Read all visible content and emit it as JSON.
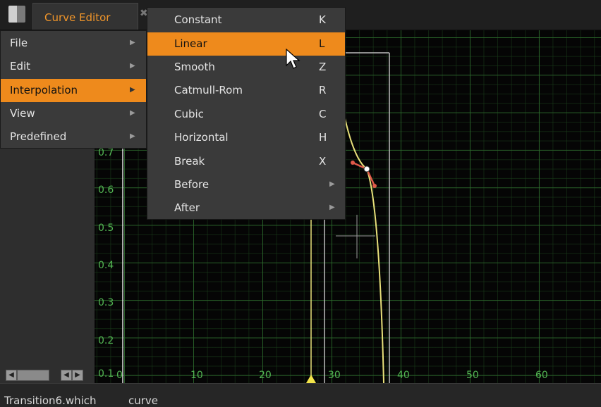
{
  "tab": {
    "label": "Curve Editor",
    "close": "✖"
  },
  "menu": {
    "items": [
      {
        "label": "File",
        "has_submenu": true,
        "active": false
      },
      {
        "label": "Edit",
        "has_submenu": true,
        "active": false
      },
      {
        "label": "Interpolation",
        "has_submenu": true,
        "active": true
      },
      {
        "label": "View",
        "has_submenu": true,
        "active": false
      },
      {
        "label": "Predefined",
        "has_submenu": true,
        "active": false
      }
    ]
  },
  "submenu": {
    "items": [
      {
        "label": "Constant",
        "shortcut": "K",
        "active": false
      },
      {
        "label": "Linear",
        "shortcut": "L",
        "active": true
      },
      {
        "label": "Smooth",
        "shortcut": "Z",
        "active": false
      },
      {
        "label": "Catmull-Rom",
        "shortcut": "R",
        "active": false
      },
      {
        "label": "Cubic",
        "shortcut": "C",
        "active": false
      },
      {
        "label": "Horizontal",
        "shortcut": "H",
        "active": false
      },
      {
        "label": "Break",
        "shortcut": "X",
        "active": false
      },
      {
        "label": "Before",
        "shortcut": "",
        "submenu": true,
        "active": false
      },
      {
        "label": "After",
        "shortcut": "",
        "submenu": true,
        "active": false
      }
    ]
  },
  "graph": {
    "y_labels": [
      "0.7",
      "0.6",
      "0.5",
      "0.4",
      "0.3",
      "0.2",
      "0.1"
    ],
    "x_labels": [
      "0",
      "10",
      "20",
      "30",
      "40",
      "50",
      "60"
    ]
  },
  "status": {
    "node": "Transition6.which",
    "knob": "curve"
  },
  "scroll": {
    "left_arrow": "◀",
    "right_arrow": "▶"
  },
  "colors": {
    "accent": "#ee8a1c",
    "grid": "#2e6e2e",
    "axis_label": "#53b653",
    "curve": "#e8e07a",
    "tangent": "#e05a4a"
  }
}
